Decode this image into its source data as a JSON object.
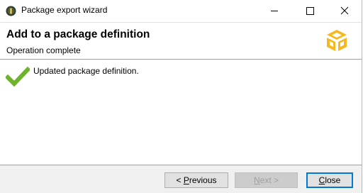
{
  "window": {
    "title": "Package export wizard"
  },
  "title_buttons": {
    "minimize_icon": "minimize-icon",
    "maximize_icon": "maximize-icon",
    "close_icon": "close-icon"
  },
  "banner": {
    "title": "Add to a package definition",
    "subtitle": "Operation complete",
    "logo_icon": "package-box-icon",
    "logo_color": "#f5b820"
  },
  "content": {
    "status_icon": "checkmark-icon",
    "status_icon_color": "#6fb32c",
    "status_message": "Updated package definition."
  },
  "buttons": {
    "previous": {
      "prefix": "< ",
      "mnemonic": "P",
      "rest": "revious"
    },
    "next": {
      "mnemonic": "N",
      "rest": "ext >",
      "enabled": false
    },
    "close": {
      "mnemonic": "C",
      "rest": "lose"
    }
  },
  "colors": {
    "focus_border": "#0078d7",
    "button_bar_bg": "#f0f0f0"
  }
}
